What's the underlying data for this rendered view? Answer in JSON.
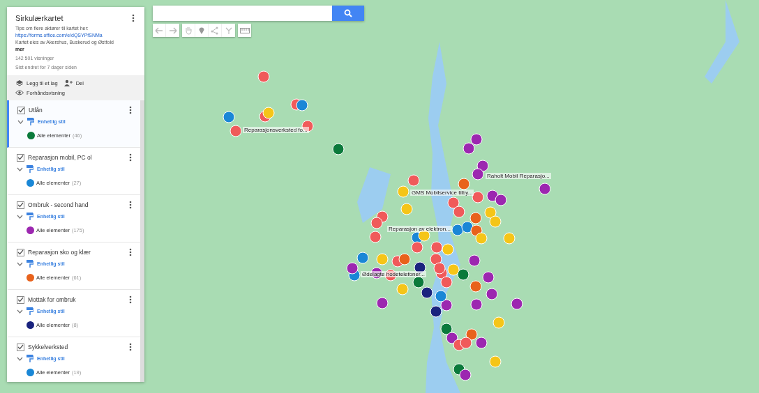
{
  "map": {
    "title": "Sirkulærkartet",
    "description": "Tips om flere aktører til kartet her:",
    "link": "https://forms.office.com/e/dQSYPfSNMa",
    "owner": "Kartet eies av Akershus, Buskerud og Østfold",
    "more": "mer",
    "views": "142 501 visninger",
    "edited": "Sist endret for 7 dager siden"
  },
  "actions": [
    {
      "kind": "layer",
      "label": "Legg til et lag"
    },
    {
      "kind": "share",
      "label": "Del"
    },
    {
      "kind": "preview",
      "label": "Forhåndsvisning"
    }
  ],
  "layers": [
    {
      "name": "Utlån",
      "checked": true,
      "expanded": true,
      "selected": true,
      "style": "Enhetlig stil",
      "items": "Alle elementer",
      "count": "(46)",
      "color": "#0b7a3b"
    },
    {
      "name": "Reparasjon mobil, PC ol",
      "checked": true,
      "expanded": true,
      "selected": false,
      "style": "Enhetlig stil",
      "items": "Alle elementer",
      "count": "(27)",
      "color": "#1a87d6"
    },
    {
      "name": "Ombruk - second hand",
      "checked": true,
      "expanded": true,
      "selected": false,
      "style": "Enhetlig stil",
      "items": "Alle elementer",
      "count": "(175)",
      "color": "#9c27b0"
    },
    {
      "name": "Reparasjon sko og klær",
      "checked": true,
      "expanded": true,
      "selected": false,
      "style": "Enhetlig stil",
      "items": "Alle elementer",
      "count": "(61)",
      "color": "#e8621c"
    },
    {
      "name": "Mottak for ombruk",
      "checked": true,
      "expanded": true,
      "selected": false,
      "style": "Enhetlig stil",
      "items": "Alle elementer",
      "count": "(8)",
      "color": "#1a237e"
    },
    {
      "name": "Sykkelverksted",
      "checked": true,
      "expanded": true,
      "selected": false,
      "style": "Enhetlig stil",
      "items": "Alle elementer",
      "count": "(19)",
      "color": "#1a87d6"
    }
  ],
  "marker_labels": [
    "Reparasjonsverksted fo...",
    "Raholt Mobil Reparasjo...",
    "GMS Mobilservice tilby...",
    "Reparasjon av elektron...",
    "Ødelagte hodetelefoner..."
  ]
}
